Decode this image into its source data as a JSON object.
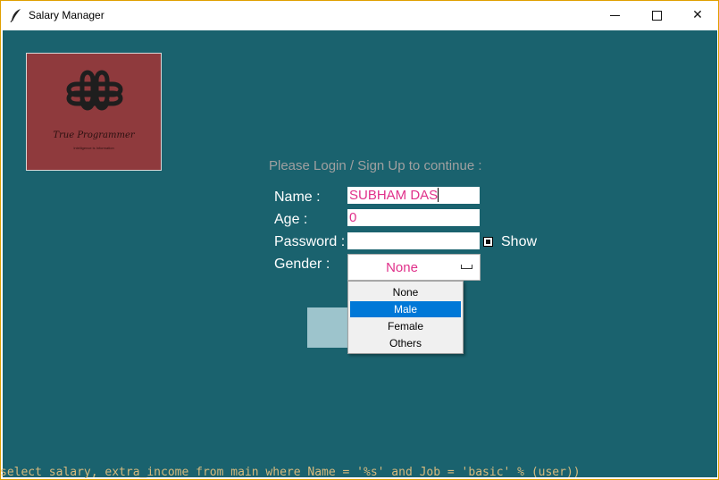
{
  "window": {
    "title": "Salary Manager",
    "icon": "feather-icon",
    "controls": {
      "minimize": "minimize-icon",
      "maximize": "maximize-icon",
      "close": "close-icon"
    },
    "close_glyph": "✕",
    "background": "#1a626e"
  },
  "logo": {
    "brand": "True Programmer",
    "tagline": "Intelligence is Information",
    "background": "#8f3a3d"
  },
  "form": {
    "prompt": "Please Login / Sign Up to continue :",
    "name_label": "Name :",
    "name_value": "SUBHAM DAS",
    "age_label": "Age  :",
    "age_value": "0",
    "password_label": "Password :",
    "password_value": "",
    "show_label": "Show",
    "gender_label": "Gender :",
    "gender_value": "None",
    "value_color": "#e0308a"
  },
  "gender_menu": {
    "options": [
      "None",
      "Male",
      "Female",
      "Others"
    ],
    "highlighted": "Male",
    "highlight_color": "#0078d7"
  },
  "background_code": "select salary, extra_income from main where Name = '%s' and Job = 'basic' % (user))"
}
